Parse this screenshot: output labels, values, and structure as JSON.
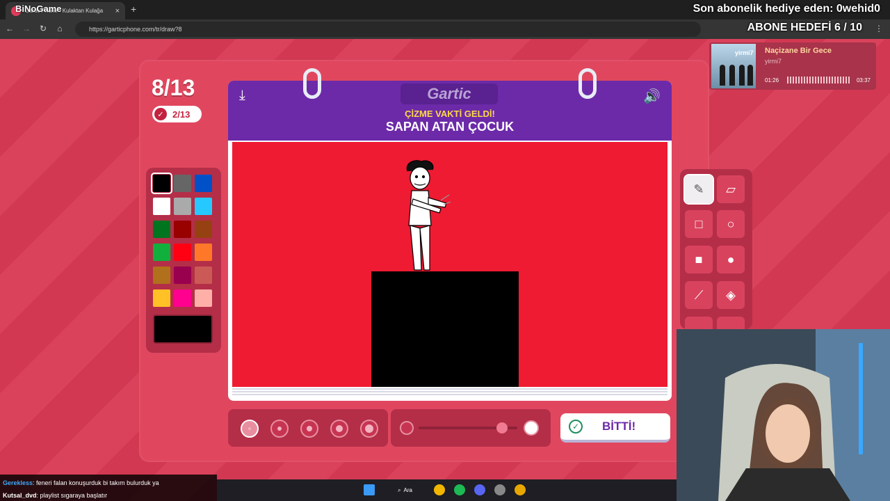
{
  "browser": {
    "tab_title": "Gartic Phone - Kulaktan Kulağa",
    "url": "https://garticphone.com/tr/draw?8",
    "new_tab": "+",
    "close": "×"
  },
  "overlay": {
    "logo": "BiNoGame",
    "sub_text": "Son abonelik hediye eden: 0wehid0",
    "goal_text": "ABONE HEDEFİ 6 / 10"
  },
  "game": {
    "round": "8/13",
    "progress": "2/13",
    "logo": "Gartic",
    "prompt_top": "ÇİZME VAKTİ GELDİ!",
    "prompt": "SAPAN ATAN ÇOCUK",
    "done_label": "BİTTİ!",
    "selected_color": "#000000",
    "colors": [
      "#000000",
      "#666666",
      "#0050c8",
      "#ffffff",
      "#aaaaaa",
      "#26c9ff",
      "#017420",
      "#990000",
      "#964112",
      "#11b03c",
      "#ff0013",
      "#ff7829",
      "#b0701c",
      "#99004e",
      "#cb5a57",
      "#ffc126",
      "#ff008f",
      "#feafa8"
    ],
    "brush_sizes": [
      1,
      2,
      3,
      4,
      5
    ],
    "selected_size": 1
  },
  "music": {
    "song": "Naçizane Bir Gece",
    "artist": "yirmi7",
    "cover_text": "yirmi7",
    "elapsed": "01:26",
    "total": "03:37"
  },
  "chat": [
    {
      "user": "Gerekless",
      "message": ": feneri falan konuşurduk bi takım bulurduk ya"
    },
    {
      "user": "Kutsal_dvd",
      "message": ": playlist sıgaraya başlatır"
    }
  ],
  "taskbar": {
    "search": "Ara"
  }
}
